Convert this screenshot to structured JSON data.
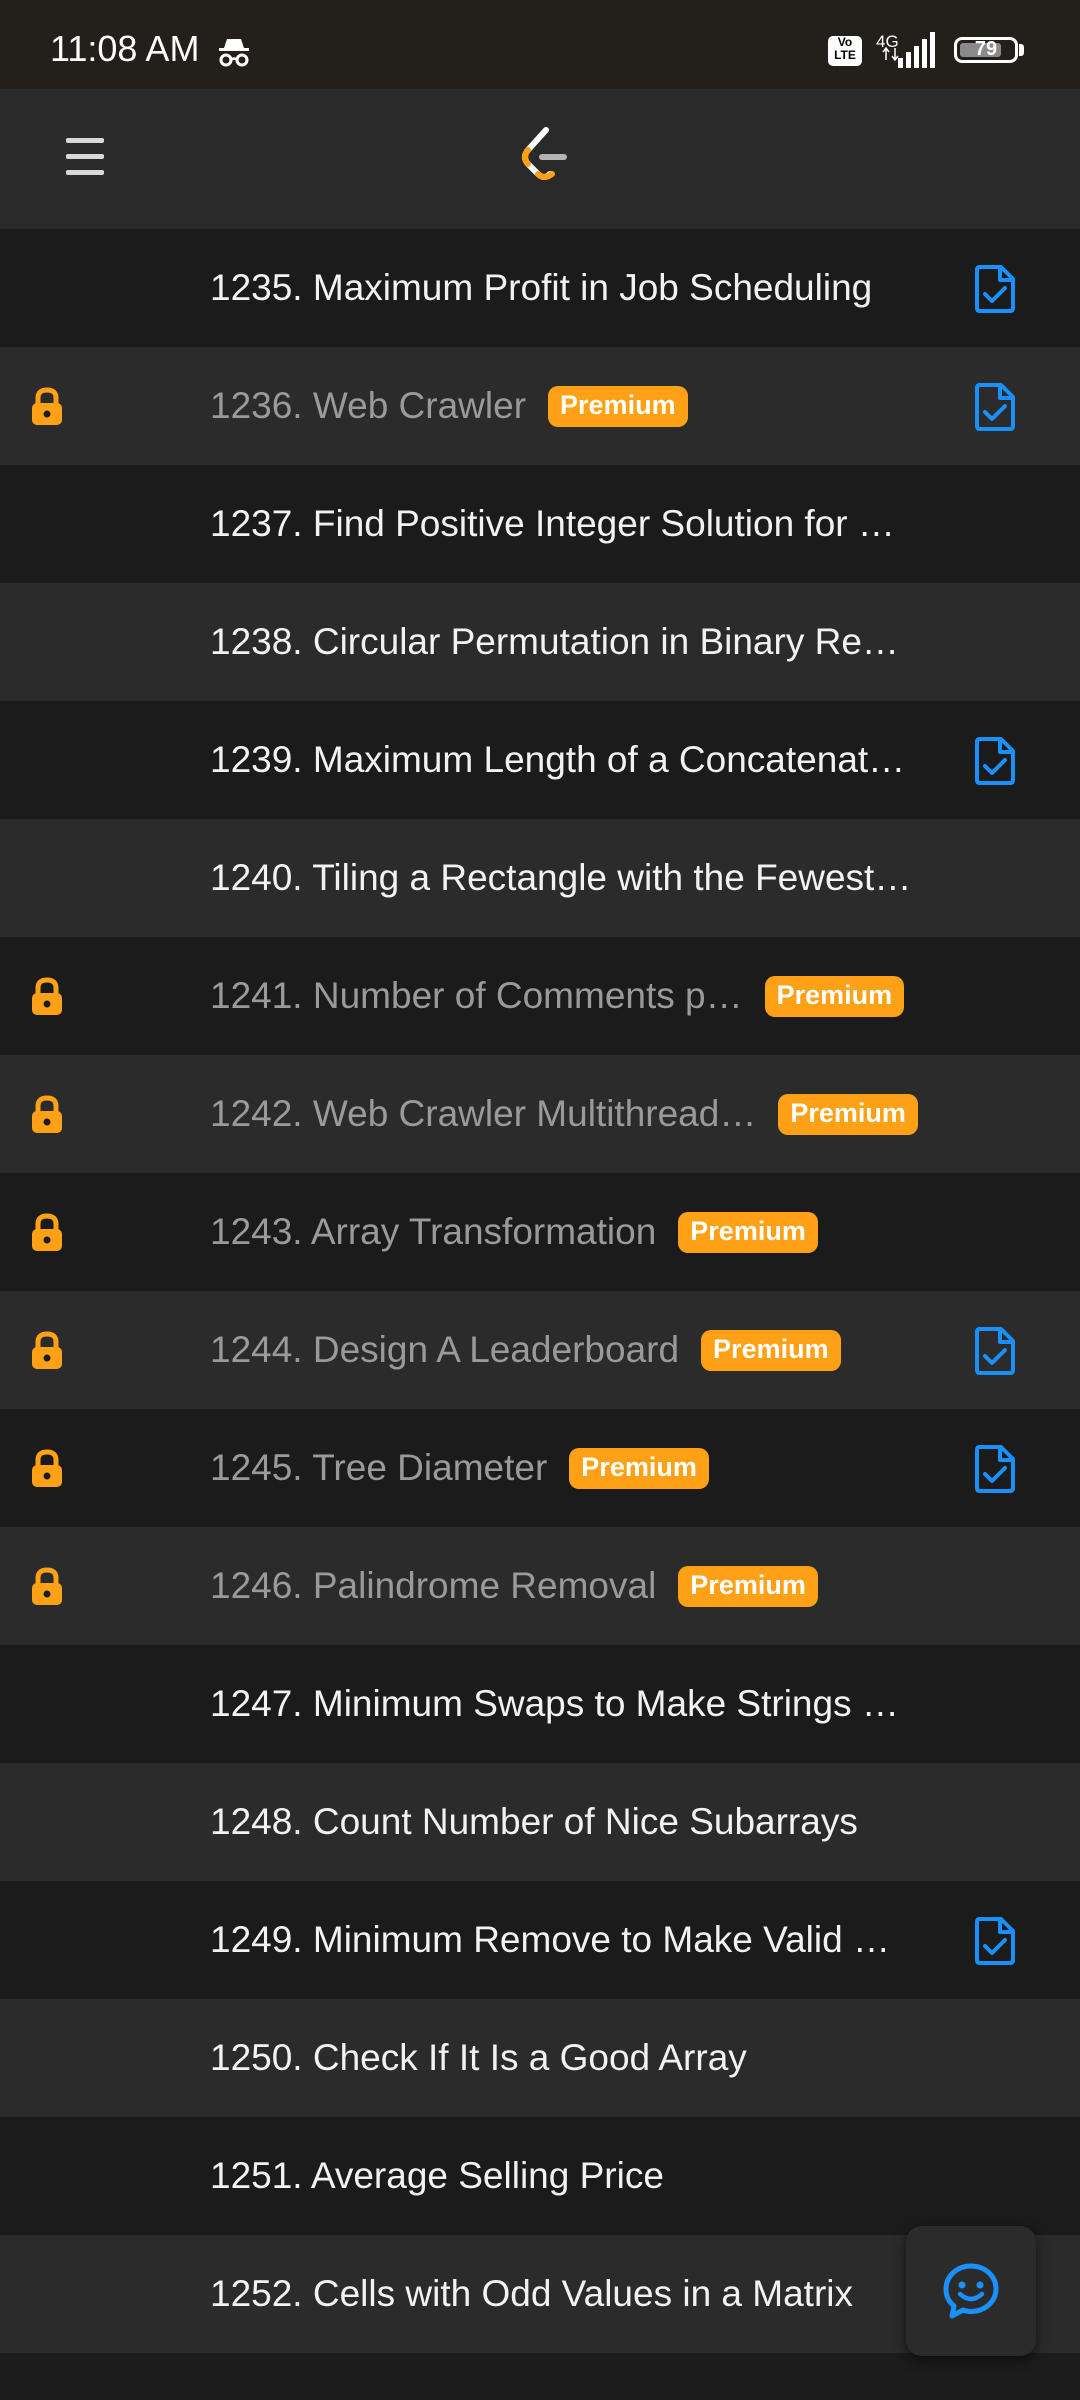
{
  "status_bar": {
    "time": "11:08 AM",
    "icons": [
      "incognito-icon",
      "volte-icon",
      "signal-icon",
      "battery-icon"
    ],
    "volte_label": "Vo LTE",
    "network": "4G",
    "battery_level": "79"
  },
  "header": {
    "menu_icon": "hamburger-menu-icon",
    "logo": "leetcode-logo"
  },
  "colors": {
    "premium": "#ffa116",
    "lock": "#ffa116",
    "solved_icon": "#1a90ff"
  },
  "problems": [
    {
      "title": "1235. Maximum Profit in Job Scheduling",
      "locked": false,
      "premium": false,
      "solved": true
    },
    {
      "title": "1236. Web Crawler",
      "locked": true,
      "premium": true,
      "solved": true
    },
    {
      "title": "1237. Find Positive Integer Solution for …",
      "locked": false,
      "premium": false,
      "solved": false
    },
    {
      "title": "1238. Circular Permutation in Binary Re…",
      "locked": false,
      "premium": false,
      "solved": false
    },
    {
      "title": "1239. Maximum Length of a Concatenat…",
      "locked": false,
      "premium": false,
      "solved": true
    },
    {
      "title": "1240. Tiling a Rectangle with the Fewest…",
      "locked": false,
      "premium": false,
      "solved": false
    },
    {
      "title": "1241. Number of Comments p…",
      "locked": true,
      "premium": true,
      "solved": false
    },
    {
      "title": "1242. Web Crawler Multithread…",
      "locked": true,
      "premium": true,
      "solved": false
    },
    {
      "title": "1243. Array Transformation",
      "locked": true,
      "premium": true,
      "solved": false
    },
    {
      "title": "1244. Design A Leaderboard",
      "locked": true,
      "premium": true,
      "solved": true
    },
    {
      "title": "1245. Tree Diameter",
      "locked": true,
      "premium": true,
      "solved": true
    },
    {
      "title": "1246. Palindrome Removal",
      "locked": true,
      "premium": true,
      "solved": false
    },
    {
      "title": "1247. Minimum Swaps to Make Strings …",
      "locked": false,
      "premium": false,
      "solved": false
    },
    {
      "title": "1248. Count Number of Nice Subarrays",
      "locked": false,
      "premium": false,
      "solved": false
    },
    {
      "title": "1249. Minimum Remove to Make Valid …",
      "locked": false,
      "premium": false,
      "solved": true
    },
    {
      "title": "1250. Check If It Is a Good Array",
      "locked": false,
      "premium": false,
      "solved": false
    },
    {
      "title": "1251. Average Selling Price",
      "locked": false,
      "premium": false,
      "solved": false
    },
    {
      "title": "1252. Cells with Odd Values in a Matrix",
      "locked": false,
      "premium": false,
      "solved": false
    }
  ],
  "premium_label": "Premium",
  "fab": {
    "icon": "chat-smile-icon"
  }
}
